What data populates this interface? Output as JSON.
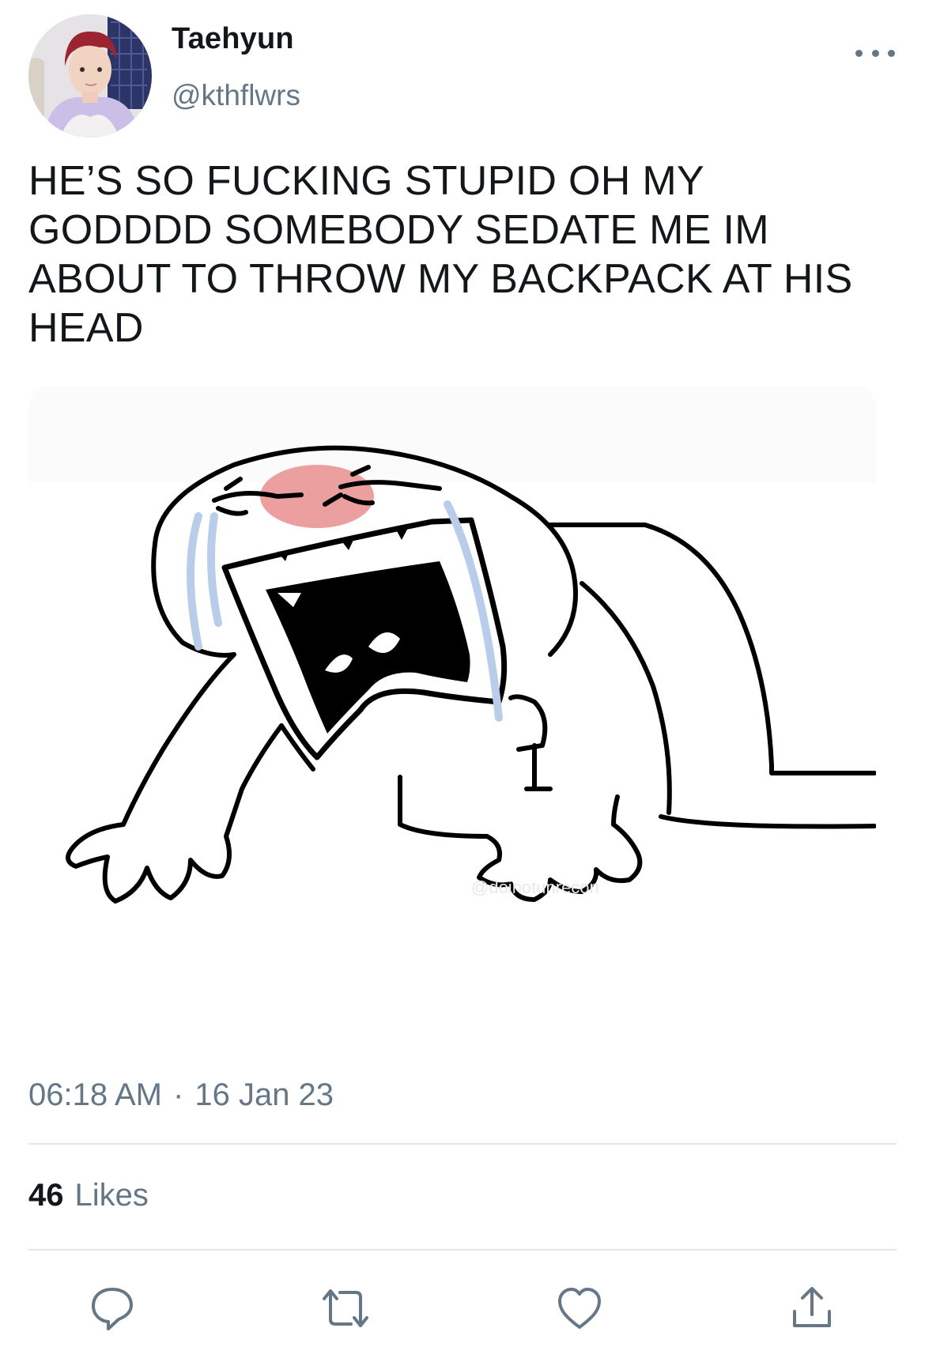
{
  "author": {
    "display_name": "Taehyun",
    "handle": "@kthflwrs",
    "avatar_icon": "profile-photo"
  },
  "tweet": {
    "text": "HE’S SO FUCKING STUPID OH MY GODDDD SOMEBODY SEDATE ME IM ABOUT TO THROW MY BACKPACK AT HIS HEAD",
    "media_icon": "screaming-crying-cartoon-meme"
  },
  "meta": {
    "time": "06:18 AM",
    "separator": "·",
    "date": "16 Jan 23"
  },
  "stats": {
    "likes_count": "46",
    "likes_label": "Likes"
  },
  "actions": {
    "icons": [
      "reply-icon",
      "retweet-icon",
      "like-icon",
      "share-icon"
    ]
  },
  "colors": {
    "text": "#14171a",
    "secondary": "#657786",
    "divider": "#e1e8ed",
    "blush": "#e88e8e",
    "tears": "#b9cdea"
  }
}
